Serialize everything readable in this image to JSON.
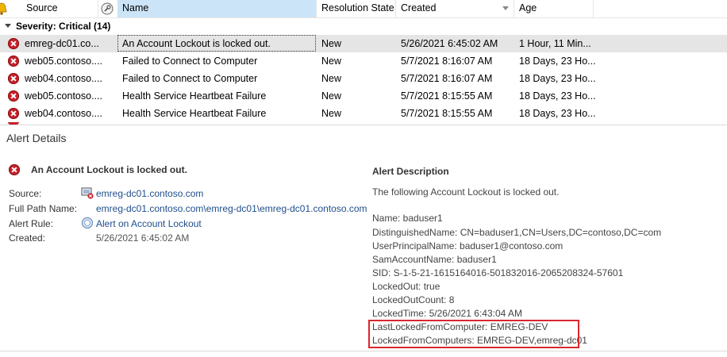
{
  "columns": {
    "source": "Source",
    "name": "Name",
    "resolution_state": "Resolution State",
    "created": "Created",
    "age": "Age"
  },
  "group_header": "Severity: Critical (14)",
  "rows": [
    {
      "source": "emreg-dc01.co...",
      "name": "An Account Lockout is locked out.",
      "state": "New",
      "created": "5/26/2021 6:45:02 AM",
      "age": "1 Hour, 11 Min..."
    },
    {
      "source": "web05.contoso....",
      "name": "Failed to Connect to Computer",
      "state": "New",
      "created": "5/7/2021 8:16:07 AM",
      "age": "18 Days, 23 Ho..."
    },
    {
      "source": "web04.contoso....",
      "name": "Failed to Connect to Computer",
      "state": "New",
      "created": "5/7/2021 8:16:07 AM",
      "age": "18 Days, 23 Ho..."
    },
    {
      "source": "web05.contoso....",
      "name": "Health Service Heartbeat Failure",
      "state": "New",
      "created": "5/7/2021 8:15:55 AM",
      "age": "18 Days, 23 Ho..."
    },
    {
      "source": "web04.contoso....",
      "name": "Health Service Heartbeat Failure",
      "state": "New",
      "created": "5/7/2021 8:15:55 AM",
      "age": "18 Days, 23 Ho..."
    }
  ],
  "details": {
    "title": "Alert Details",
    "alert_name": "An Account Lockout is locked out.",
    "labels": {
      "source": "Source:",
      "full_path": "Full Path Name:",
      "alert_rule": "Alert Rule:",
      "created": "Created:"
    },
    "source": "emreg-dc01.contoso.com",
    "full_path_link": "emreg-dc01.contoso.com\\emreg-dc01",
    "full_path_rest": "\\emreg-dc01.contoso.com",
    "alert_rule": "Alert on Account Lockout",
    "created": "5/26/2021 6:45:02 AM"
  },
  "description": {
    "heading": "Alert Description",
    "intro": "The following Account Lockout is locked out.",
    "lines": [
      "Name: baduser1",
      "DistinguishedName: CN=baduser1,CN=Users,DC=contoso,DC=com",
      "UserPrincipalName: baduser1@contoso.com",
      "SamAccountName: baduser1",
      "SID: S-1-5-21-1615164016-501832016-2065208324-57601",
      "LockedOut: true",
      "LockedOutCount: 8",
      "LockedTime: 5/26/2021 6:43:04 AM",
      "LastLockedFromComputer: EMREG-DEV",
      "LockedFromComputers: EMREG-DEV,emreg-dc01"
    ]
  },
  "colors": {
    "selected_header": "#cce4f7",
    "error_red": "#c5212a",
    "highlight_box": "#d9272e",
    "link": "#1f4e8c"
  }
}
